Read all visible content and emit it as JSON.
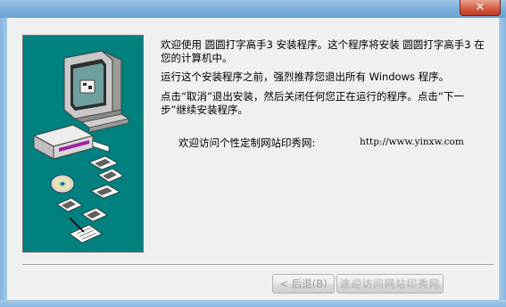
{
  "window": {
    "close_glyph": "✕"
  },
  "content": {
    "paragraph1": "欢迎使用 圆圆打字高手3 安装程序。这个程序将安装 圆圆打字高手3 在您的计算机中。",
    "paragraph2": "运行这个安装程序之前，强烈推荐您退出所有 Windows 程序。",
    "paragraph3": "点击“取消”退出安装，然后关闭任何您正在运行的程序。点击“下一步”继续安装程序。",
    "site_label": "欢迎访问个性定制网站印秀网:",
    "site_url": "http://www.yinxw.com"
  },
  "buttons": {
    "back_label": "< 后退(B)",
    "next_label": "途迎访问网站印秀网"
  },
  "colors": {
    "panel_teal": "#00807f",
    "close_red": "#c13a22"
  },
  "icons": [
    "computer-icon",
    "drive-icon",
    "floppy-disk-icon",
    "cd-icon",
    "document-pen-icon"
  ]
}
